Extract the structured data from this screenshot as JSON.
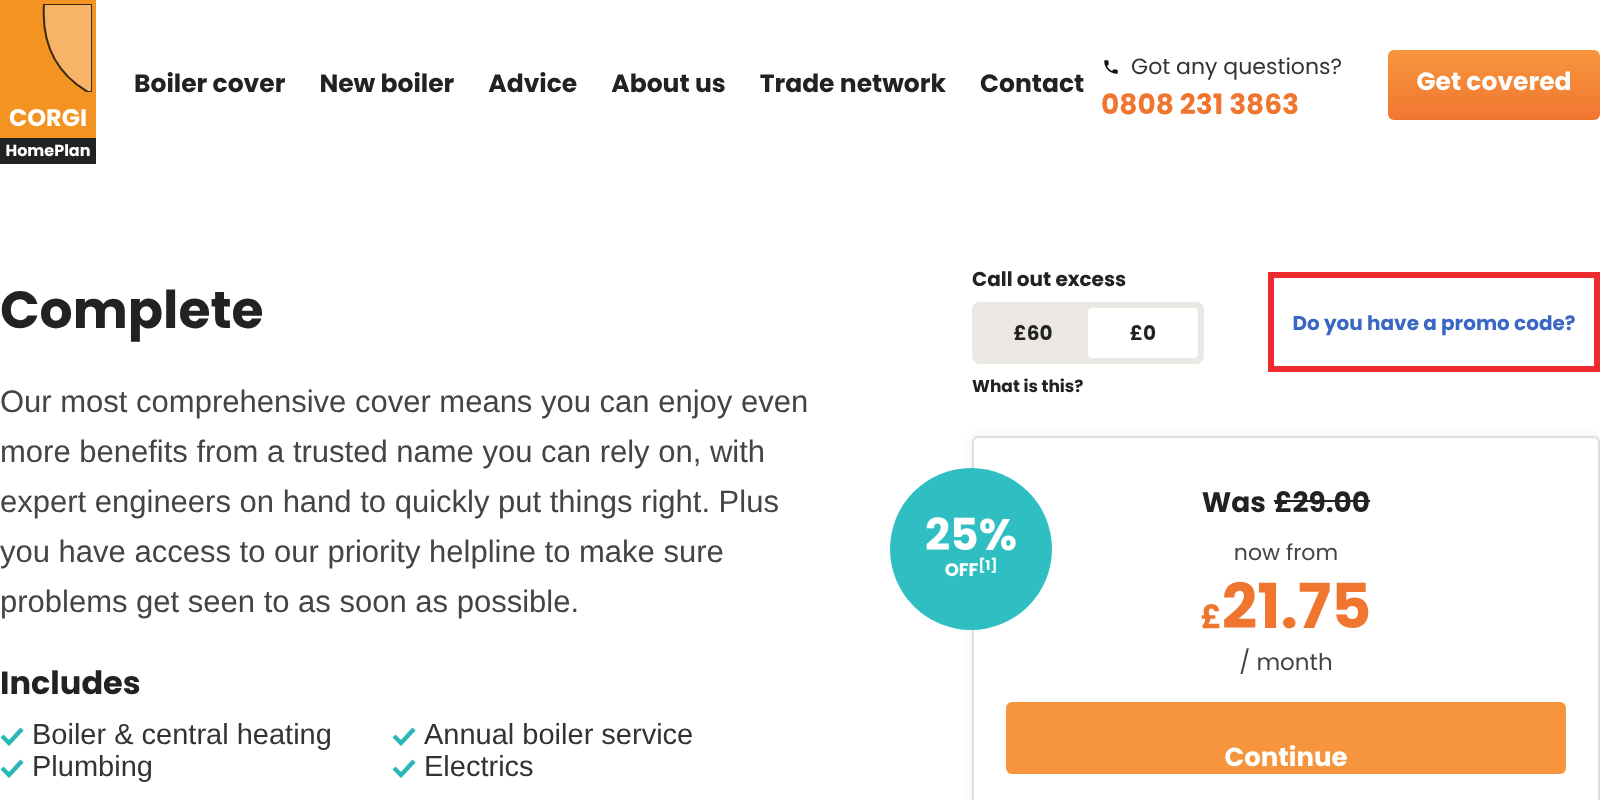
{
  "logo": {
    "brand": "CORGI",
    "sub": "HomePlan"
  },
  "nav": [
    "Boiler cover",
    "New boiler",
    "Advice",
    "About us",
    "Trade network",
    "Contact"
  ],
  "contact": {
    "question": "Got any questions?",
    "phone": "0808 231 3863"
  },
  "cta": "Get covered",
  "product": {
    "title": "Complete",
    "description": "Our most comprehensive cover means you can enjoy even more benefits from a trusted name you can rely on, with expert engineers on hand to quickly put things right. Plus you have access to our priority helpline to make sure problems get seen to as soon as possible."
  },
  "includes": {
    "heading": "Includes",
    "items": [
      "Boiler & central heating",
      "Annual boiler service",
      "Plumbing",
      "Electrics"
    ]
  },
  "excess": {
    "label": "Call out excess",
    "options": [
      {
        "label": "£60",
        "selected": false
      },
      {
        "label": "£0",
        "selected": true
      }
    ],
    "help": "What is this?"
  },
  "promo": "Do you have a promo code?",
  "badge": {
    "percent": "25%",
    "text": "OFF$^{[1]}$"
  },
  "price": {
    "was_label": "Was",
    "was": "£29.00",
    "from": "now from",
    "currency": "£",
    "amount": "21.75",
    "period": "/ month",
    "button": "Continue"
  }
}
